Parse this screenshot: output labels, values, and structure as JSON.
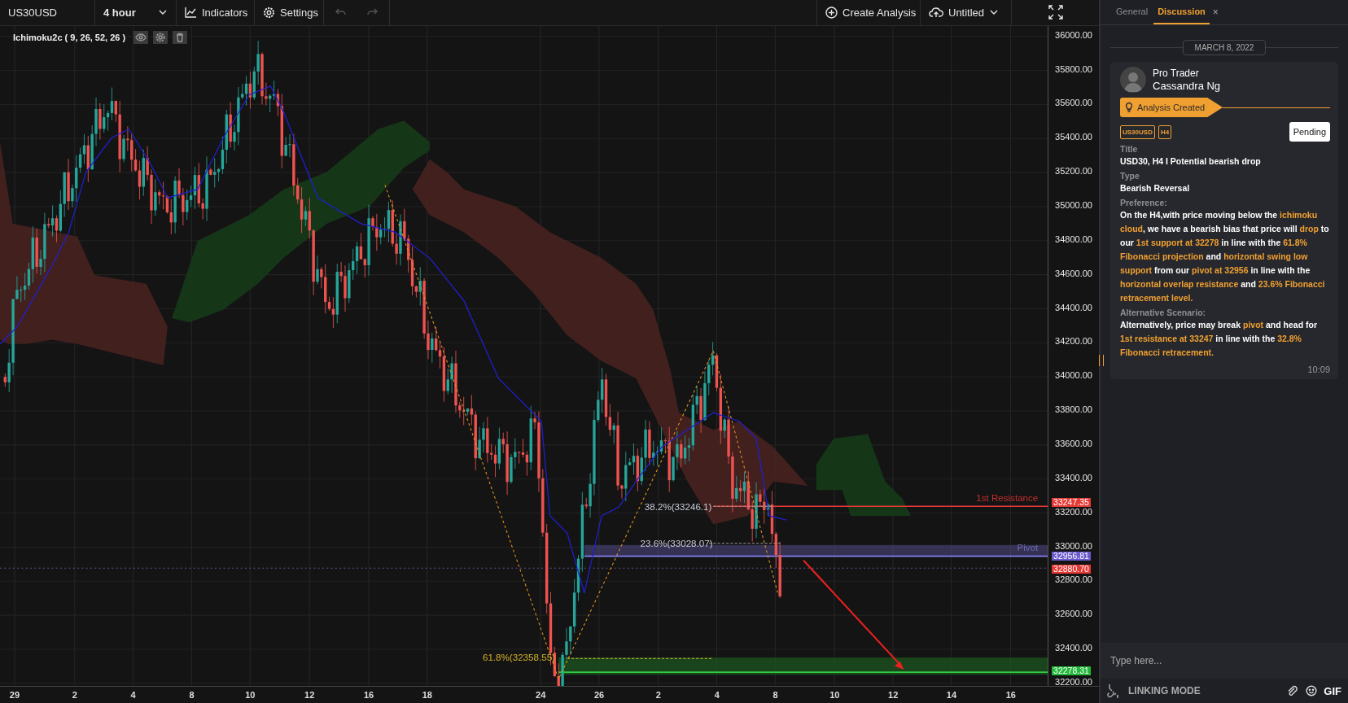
{
  "toolbar": {
    "symbol": "US30USD",
    "interval": "4 hour",
    "indicators": "Indicators",
    "settings": "Settings",
    "undo_disabled": true,
    "redo_disabled": true,
    "create": "Create Analysis",
    "layout": "Untitled"
  },
  "chart": {
    "legend": "Ichimoku2c ( 9, 26, 52, 26 )",
    "price_ticks": [
      "36000.00",
      "35800.00",
      "35600.00",
      "35400.00",
      "35200.00",
      "35000.00",
      "34800.00",
      "34600.00",
      "34400.00",
      "34200.00",
      "34000.00",
      "33800.00",
      "33600.00",
      "33400.00",
      "33200.00",
      "33000.00",
      "32800.00",
      "32600.00",
      "32400.00",
      "32200.00"
    ],
    "time_ticks": [
      "29",
      "2",
      "4",
      "8",
      "10",
      "12",
      "16",
      "18",
      "24",
      "26",
      "2",
      "4",
      "8",
      "10",
      "12",
      "14",
      "16"
    ],
    "price_tags": [
      {
        "text": "33247.35",
        "color": "#e53935"
      },
      {
        "text": "32956.81",
        "color": "#6a5acd"
      },
      {
        "text": "32880.70",
        "color": "#e53935"
      },
      {
        "text": "32278.31",
        "color": "#22b83a"
      }
    ],
    "annotations": [
      {
        "kind": "resistance",
        "text": "1st Resistance"
      },
      {
        "kind": "pivot",
        "text": "Pivot"
      },
      {
        "kind": "fib382",
        "text": "38.2%(33246.1)"
      },
      {
        "kind": "fib236",
        "text": "23.6%(33028.07)"
      },
      {
        "kind": "fib618",
        "text": "61.8%(32358.55)"
      }
    ]
  },
  "panel": {
    "tabs": [
      {
        "label": "General",
        "selected": false,
        "closable": false
      },
      {
        "label": "Discussion",
        "selected": true,
        "closable": true
      }
    ],
    "close_mark": "×",
    "date": "MARCH 8, 2022",
    "message": {
      "role": "Pro Trader",
      "author": "Cassandra Ng",
      "banner": "Analysis Created",
      "tags": [
        "US30USD",
        "H4"
      ],
      "status": "Pending",
      "fields": [
        {
          "label": "Title",
          "value": "USD30, H4 I Potential bearish drop"
        },
        {
          "label": "Type",
          "value": "Bearish Reversal"
        },
        {
          "label": "Preference:",
          "value": "On the H4,with price moving below the **ichimoku cloud**, we have a bearish bias that price will **drop** to our **1st support at 32278** in line with the **61.8% Fibonacci projection** and **horizontal swing low support** from our **pivot at 32956** in line with the **horizontal overlap resistance** and **23.6% Fibonacci retracement level.**"
        },
        {
          "label": "Alternative Scenario:",
          "value": "Alternatively, price may break **pivot** and head for **1st resistance at 33247** in line with the **32.8% Fibonacci retracement.**"
        }
      ],
      "time": "10:09"
    },
    "composer": {
      "placeholder": "Type here...",
      "linking": "LINKING MODE",
      "gif": "GIF"
    }
  }
}
